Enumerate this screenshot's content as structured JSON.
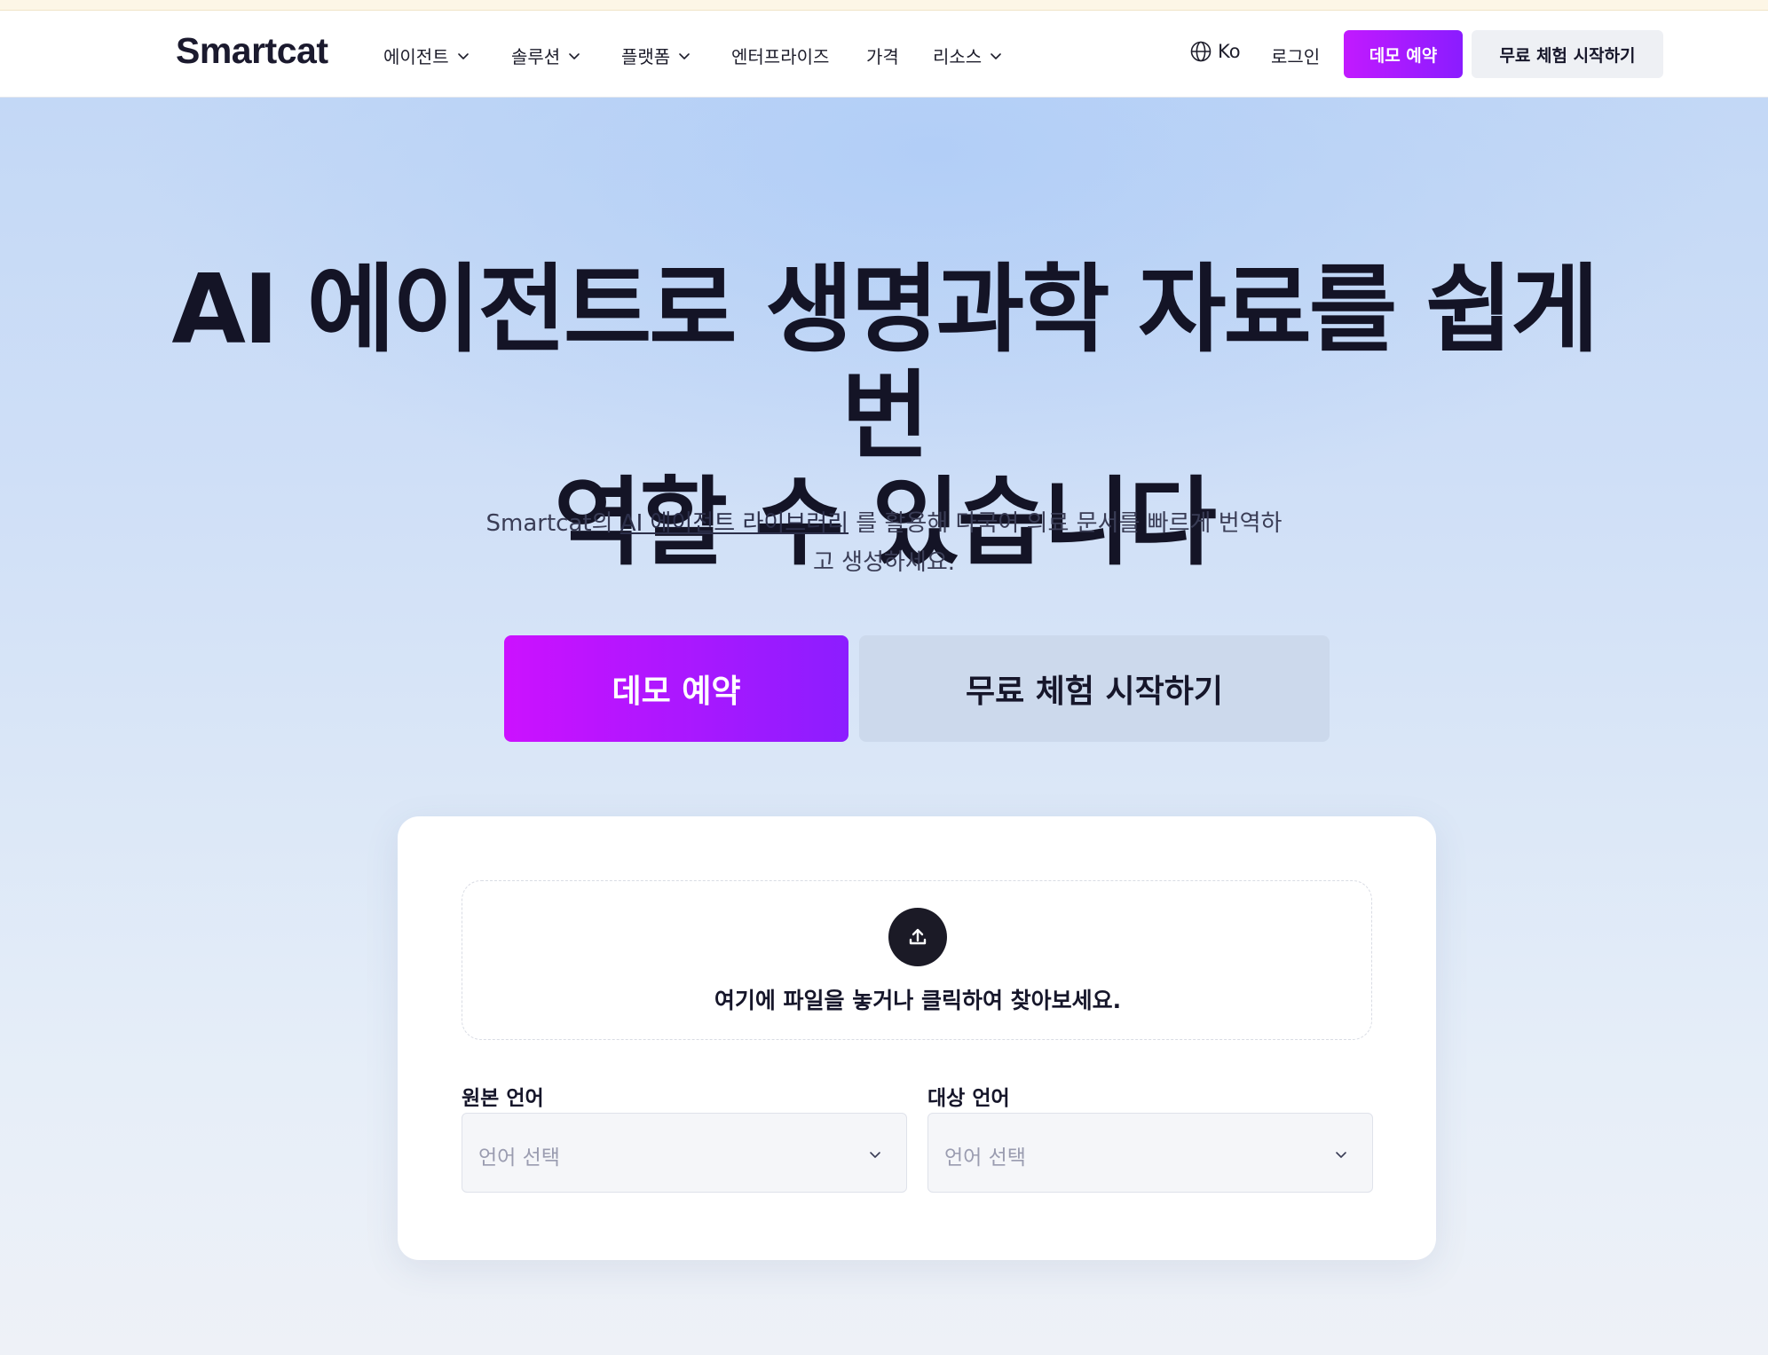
{
  "header": {
    "logo": "Smartcat",
    "nav": [
      {
        "label": "에이전트",
        "has_dropdown": true
      },
      {
        "label": "솔루션",
        "has_dropdown": true
      },
      {
        "label": "플랫폼",
        "has_dropdown": true
      },
      {
        "label": "엔터프라이즈",
        "has_dropdown": false
      },
      {
        "label": "가격",
        "has_dropdown": false
      },
      {
        "label": "리소스",
        "has_dropdown": true
      }
    ],
    "language": "Ko",
    "login": "로그인",
    "demo_button": "데모 예약",
    "trial_button": "무료 체험 시작하기"
  },
  "hero": {
    "title_line1": "AI 에이전트로 생명과학 자료를 쉽게 번",
    "title_line2": "역할 수 있습니다",
    "subtitle_prefix": "Smartcat의 ",
    "subtitle_link": "AI 에이전트 라이브러리",
    "subtitle_suffix": " 를 활용해 다국어 의료 문서를 빠르게 번역하고 생성하세요.",
    "demo_button": "데모 예약",
    "trial_button": "무료 체험 시작하기"
  },
  "upload_card": {
    "dropzone_text": "여기에 파일을 놓거나 클릭하여 찾아보세요.",
    "source_label": "원본 언어",
    "source_placeholder": "언어 선택",
    "target_label": "대상 언어",
    "target_placeholder": "언어 선택"
  },
  "colors": {
    "accent_gradient_start": "#cc11ff",
    "accent_gradient_end": "#8c1dff",
    "text_dark": "#16162a",
    "hero_bg": "#c3d8f6"
  }
}
